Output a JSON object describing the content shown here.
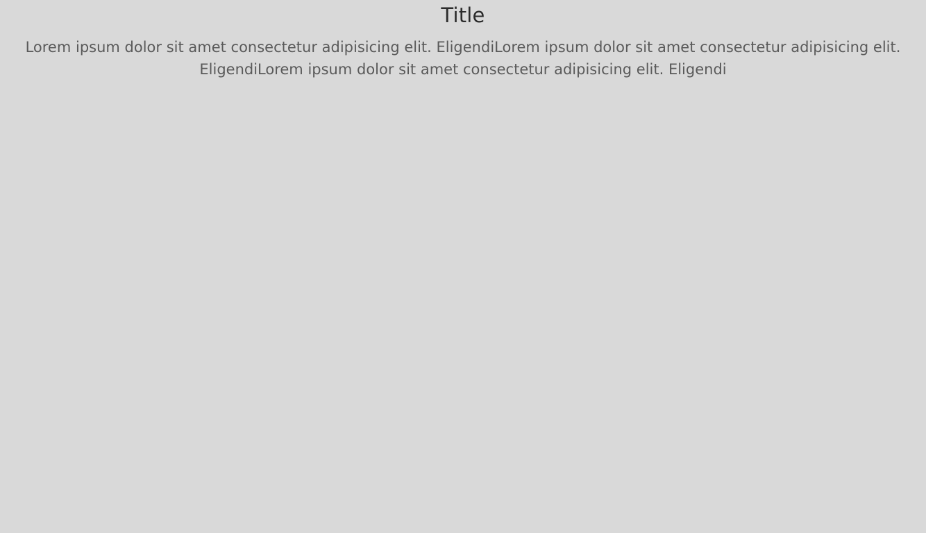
{
  "header": {
    "title": "Title"
  },
  "content": {
    "paragraph": "Lorem ipsum dolor sit amet consectetur adipisicing elit. EligendiLorem ipsum dolor sit amet consectetur adipisicing elit. EligendiLorem ipsum dolor sit amet consectetur adipisicing elit. Eligendi"
  },
  "colors": {
    "background": "#d9d9d9",
    "title_text": "#2b2b2b",
    "body_text": "#5a5a5a"
  }
}
